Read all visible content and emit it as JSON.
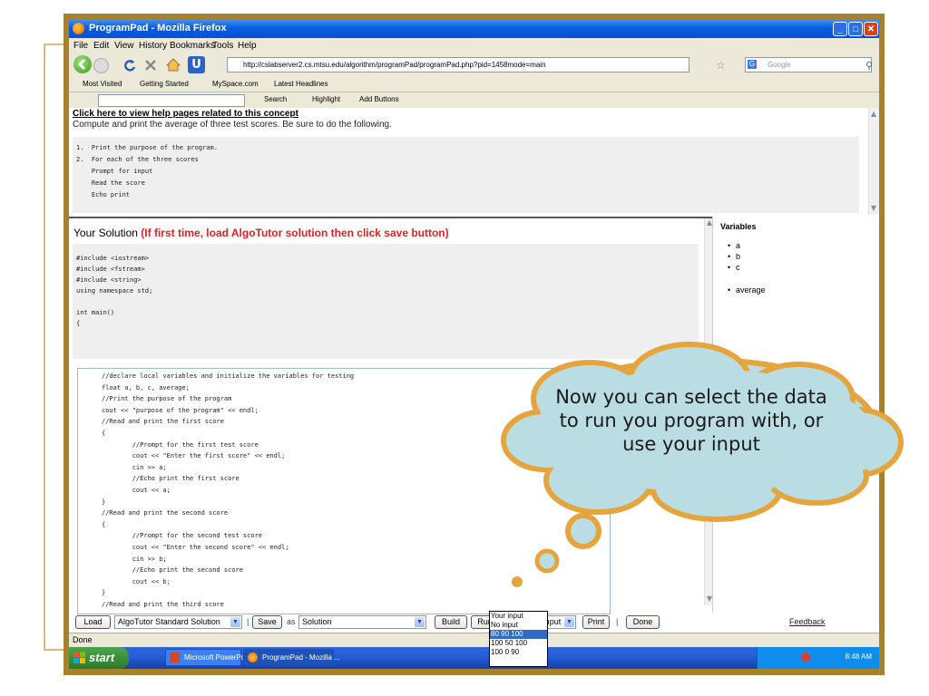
{
  "browser": {
    "window_title": "ProgramPad - Mozilla Firefox",
    "menu": [
      "File",
      "Edit",
      "View",
      "History",
      "Bookmarks",
      "Tools",
      "Help"
    ],
    "url": "http://cslabserver2.cs.mtsu.edu/algorithm/programPad/programPad.php?pid=1458mode=main",
    "search_placeholder": "Google",
    "bookmarks": [
      "Most Visited",
      "Getting Started",
      "MySpace.com",
      "Latest Headlines"
    ],
    "toolbar2": [
      "Search",
      "Highlight",
      "Add Buttons"
    ],
    "status": "Done"
  },
  "problem": {
    "help_link": "Click here to view help pages related to this concept",
    "description": "Compute and print the average of three test scores. Be sure to do the following.",
    "steps": [
      "1.  Print the purpose of the program.",
      "2.  For each of the three scores",
      "    Prompt for input",
      "    Read the score",
      "    Echo print"
    ]
  },
  "solution": {
    "title": "Your Solution",
    "instruction": "(If first time, load AlgoTutor solution then click save button)",
    "header_code": [
      "#include <iostream>",
      "#include <fstream>",
      "#include <string>",
      "using namespace std;",
      "",
      "int main()",
      "{"
    ],
    "editor_code": [
      "//declare local variables and initialize the variables for testing",
      "float a, b, c, average;",
      "//Print the purpose of the program",
      "cout << \"purpose of the program\" << endl;",
      "//Read and print the first score",
      "{",
      "        //Prompt for the first test score",
      "        cout << \"Enter the first score\" << endl;",
      "        cin >> a;",
      "        //Echo print the first score",
      "        cout << a;",
      "}",
      "//Read and print the second score",
      "{",
      "        //Prompt for the second test score",
      "        cout << \"Enter the second score\" << endl;",
      "        cin >> b;",
      "        //Echo print the second score",
      "        cout << b;",
      "}",
      "//Read and print the third score"
    ]
  },
  "variables": {
    "title": "Variables",
    "items": [
      "a",
      "b",
      "c"
    ],
    "extra": "average"
  },
  "controls": {
    "load": "Load",
    "solution_select": "AlgoTutor Standard Solution",
    "save": "Save",
    "as": "as",
    "name_select": "Solution",
    "build": "Build",
    "run": "Run",
    "with": "with",
    "input_select": "Your input",
    "print": "Print",
    "sep": "|",
    "done": "Done",
    "feedback": "Feedback"
  },
  "dropdown_options": [
    "Your input",
    "No input",
    "80 90 100",
    "100 50 100",
    "100 0 90"
  ],
  "dropdown_selected_index": 2,
  "callout": "Now you can select the data to run you program with, or use your input",
  "taskbar": {
    "start": "start",
    "items": [
      "Microsoft PowerPoint ...",
      "ProgramPad - Mozilla ..."
    ],
    "clock": "8:48 AM"
  },
  "colors": {
    "frame": "#a6822f",
    "cloud_fill": "#b9dde2",
    "cloud_stroke": "#e6a53c",
    "accent_red": "#e02020"
  }
}
